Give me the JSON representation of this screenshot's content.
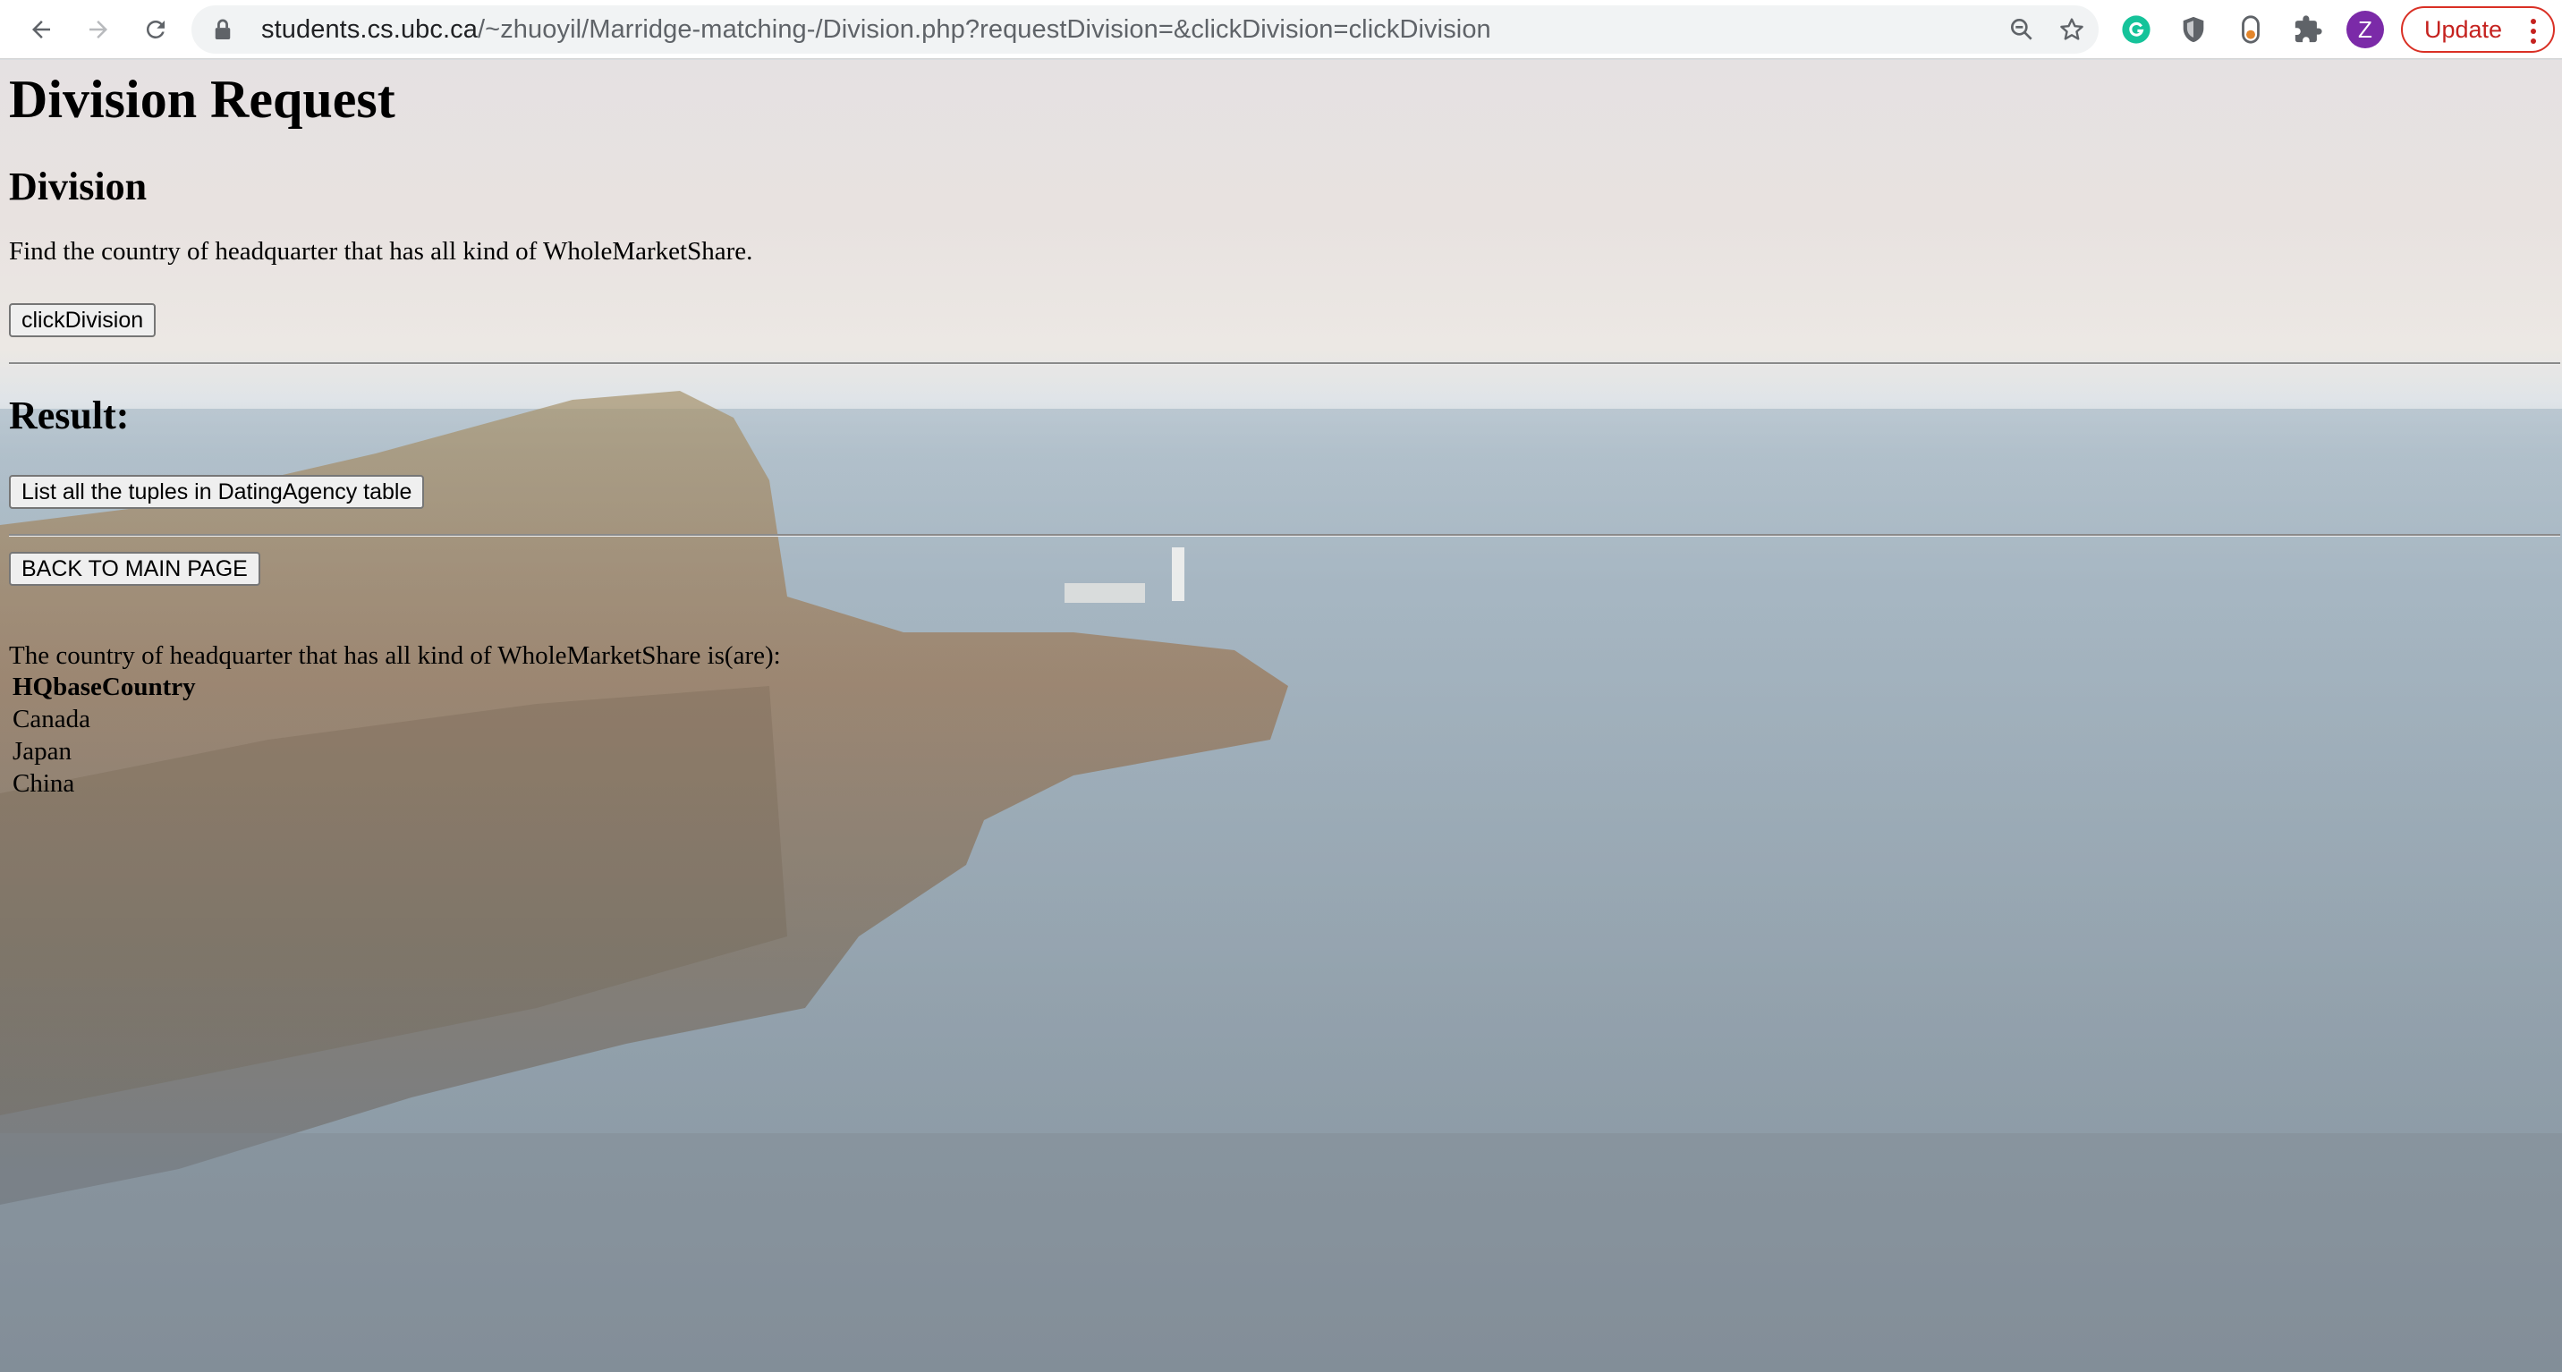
{
  "browser": {
    "url_host": "students.cs.ubc.ca",
    "url_path": "/~zhuoyil/Marridge-matching-/Division.php?requestDivision=&clickDivision=clickDivision",
    "profile_initial": "Z",
    "update_label": "Update",
    "icons": [
      "back-arrow-icon",
      "forward-arrow-icon",
      "reload-icon",
      "lock-icon",
      "zoom-icon",
      "star-icon",
      "grammarly-icon",
      "shield-extension-icon",
      "toggle-extension-icon",
      "puzzle-extensions-icon",
      "kebab-menu-icon"
    ],
    "colors": {
      "update_accent": "#d93025",
      "avatar": "#7b2aa8"
    }
  },
  "page": {
    "title": "Division Request",
    "division_heading": "Division",
    "division_description": "Find the country of headquarter that has all kind of WholeMarketShare.",
    "click_division_button": "clickDivision",
    "result_heading": "Result:",
    "list_tuples_button": "List all the tuples in DatingAgency table",
    "back_button": "BACK TO MAIN PAGE",
    "result_text": "The country of headquarter that has all kind of WholeMarketShare is(are):",
    "result_table": {
      "header": "HQbaseCountry",
      "rows": [
        "Canada",
        "Japan",
        "China"
      ]
    }
  }
}
